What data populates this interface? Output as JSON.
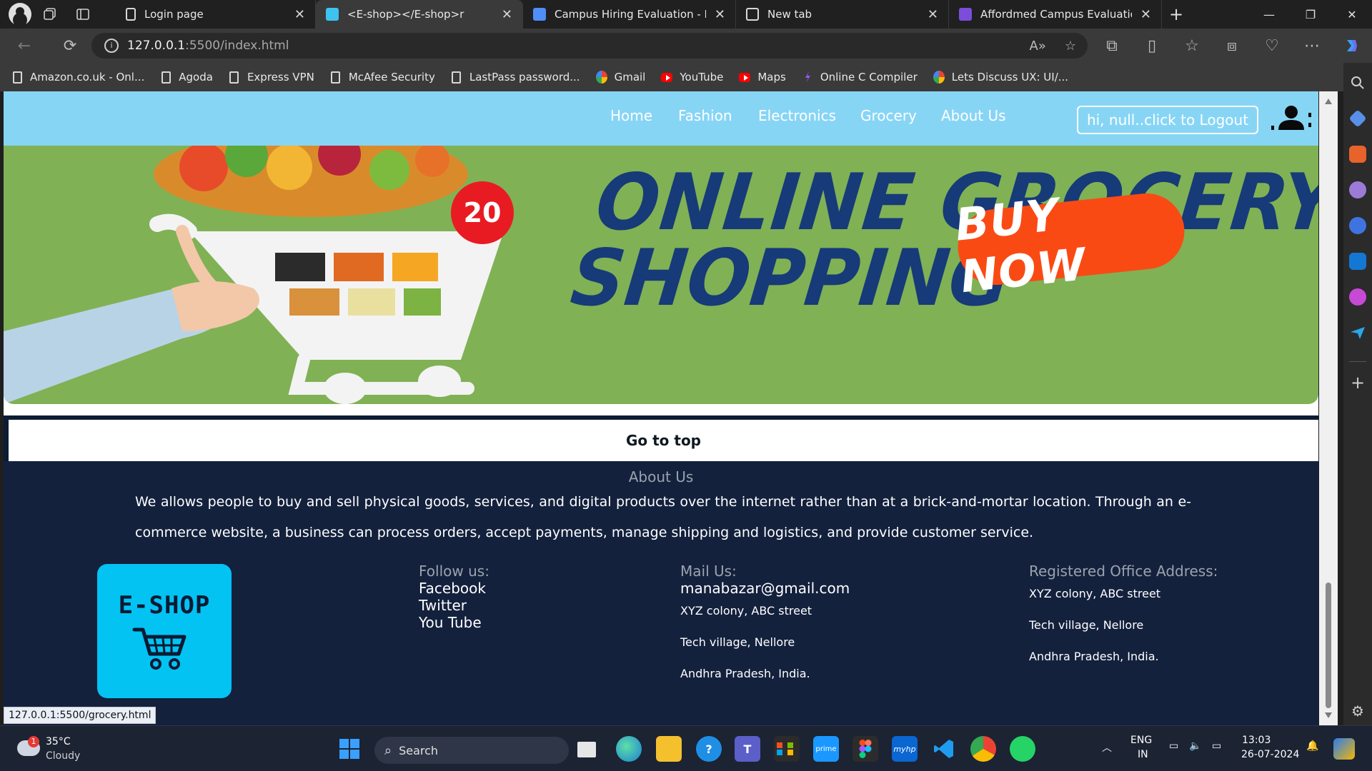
{
  "browser": {
    "tabs": [
      {
        "label": "Login page",
        "active": false
      },
      {
        "label": "<E-shop></E-shop>r",
        "active": true
      },
      {
        "label": "Campus Hiring Evaluation - From",
        "active": false
      },
      {
        "label": "New tab",
        "active": false
      },
      {
        "label": "Affordmed Campus Evaluation |",
        "active": false
      }
    ],
    "address": {
      "host": "127.0.0.1",
      "path": ":5500/index.html"
    },
    "bookmarks": [
      {
        "label": "Amazon.co.uk - Onl...",
        "icon": "document-icon"
      },
      {
        "label": "Agoda",
        "icon": "document-icon"
      },
      {
        "label": "Express VPN",
        "icon": "document-icon"
      },
      {
        "label": "McAfee Security",
        "icon": "document-icon"
      },
      {
        "label": "LastPass password...",
        "icon": "document-icon"
      },
      {
        "label": "Gmail",
        "icon": "google-icon"
      },
      {
        "label": "YouTube",
        "icon": "youtube-icon"
      },
      {
        "label": "Maps",
        "icon": "youtube-icon"
      },
      {
        "label": "Online C Compiler",
        "icon": "compiler-icon"
      },
      {
        "label": "Lets Discuss UX: UI/...",
        "icon": "google-icon"
      }
    ],
    "status_url": "127.0.0.1:5500/grocery.html"
  },
  "site": {
    "nav": {
      "links": [
        "Home",
        "Fashion",
        "Electronics",
        "Grocery",
        "About Us"
      ],
      "logout_label": "hi, null..click to Logout"
    },
    "banner": {
      "line1": "ONLINE GROCERY",
      "line2": "SHOPPING",
      "cta": "BUY NOW",
      "badge": "20"
    },
    "go_top": "Go to top",
    "footer": {
      "about_title": "About Us",
      "about_text": "We allows people to buy and sell physical goods, services, and digital products over the internet rather than at a brick-and-mortar location. Through an e-commerce website, a business can process orders, accept payments, manage shipping and logistics, and provide customer service.",
      "logo_text": "E-SHOP",
      "follow": {
        "heading": "Follow us:",
        "links": [
          "Facebook",
          "Twitter",
          "You Tube"
        ]
      },
      "mail": {
        "heading": "Mail Us:",
        "email": "manabazar@gmail.com",
        "lines": [
          "XYZ colony, ABC street",
          "Tech village, Nellore",
          "Andhra Pradesh, India."
        ]
      },
      "office": {
        "heading": "Registered Office Address:",
        "lines": [
          "XYZ colony, ABC street",
          "Tech village, Nellore",
          "Andhra Pradesh, India."
        ]
      }
    }
  },
  "taskbar": {
    "weather": {
      "temp": "35°C",
      "desc": "Cloudy",
      "badge": "1"
    },
    "search_placeholder": "Search",
    "lang": {
      "top": "ENG",
      "bottom": "IN"
    },
    "clock": {
      "time": "13:03",
      "date": "26-07-2024"
    }
  },
  "colors": {
    "nav_bg": "#87d5f5",
    "banner_bg": "#80b155",
    "footer_bg": "#13213d",
    "logo_bg": "#03c3f3",
    "cta_orange": "#fa4a14"
  }
}
